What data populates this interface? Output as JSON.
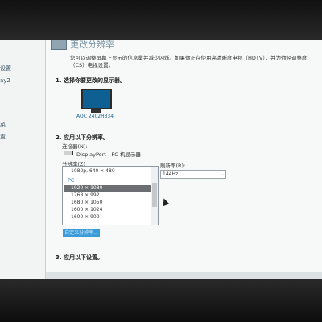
{
  "nav": {
    "items": [
      "设置",
      "ay2",
      "菜",
      "置"
    ]
  },
  "header": {
    "title": "更改分辨率"
  },
  "description": "您可以调整屏幕上显示的信息量并减少闪烁。如果你正在使用高清晰度电视（HDTV），并为你经调整度（CS）电视设置。",
  "section1": {
    "heading": "1. 选择你要更改的显示器。",
    "monitor_label": "AOC 2402H334"
  },
  "section2": {
    "heading": "2. 应用以下分辨率。",
    "connector_label": "连接器(N):",
    "connector_value": "DisplayPort - PC 机显示器",
    "resolution_label": "分辨率(Z)",
    "refresh_label": "刷新率(R):",
    "refresh_value": "144Hz",
    "resolutions_top": "1080p, 640 × 480",
    "resolution_group": "PC",
    "resolutions": [
      "1920 × 1080",
      "1768 × 992",
      "1680 × 1050",
      "1600 × 1024",
      "1600 × 900"
    ],
    "selected_index": 0,
    "properties_button": "自定义分辨率..."
  },
  "section3": {
    "heading": "3. 应用以下设置。"
  },
  "colors": {
    "accent": "#3b9bd8",
    "selected_row": "#6b6f73",
    "link": "#1a6ba8"
  }
}
